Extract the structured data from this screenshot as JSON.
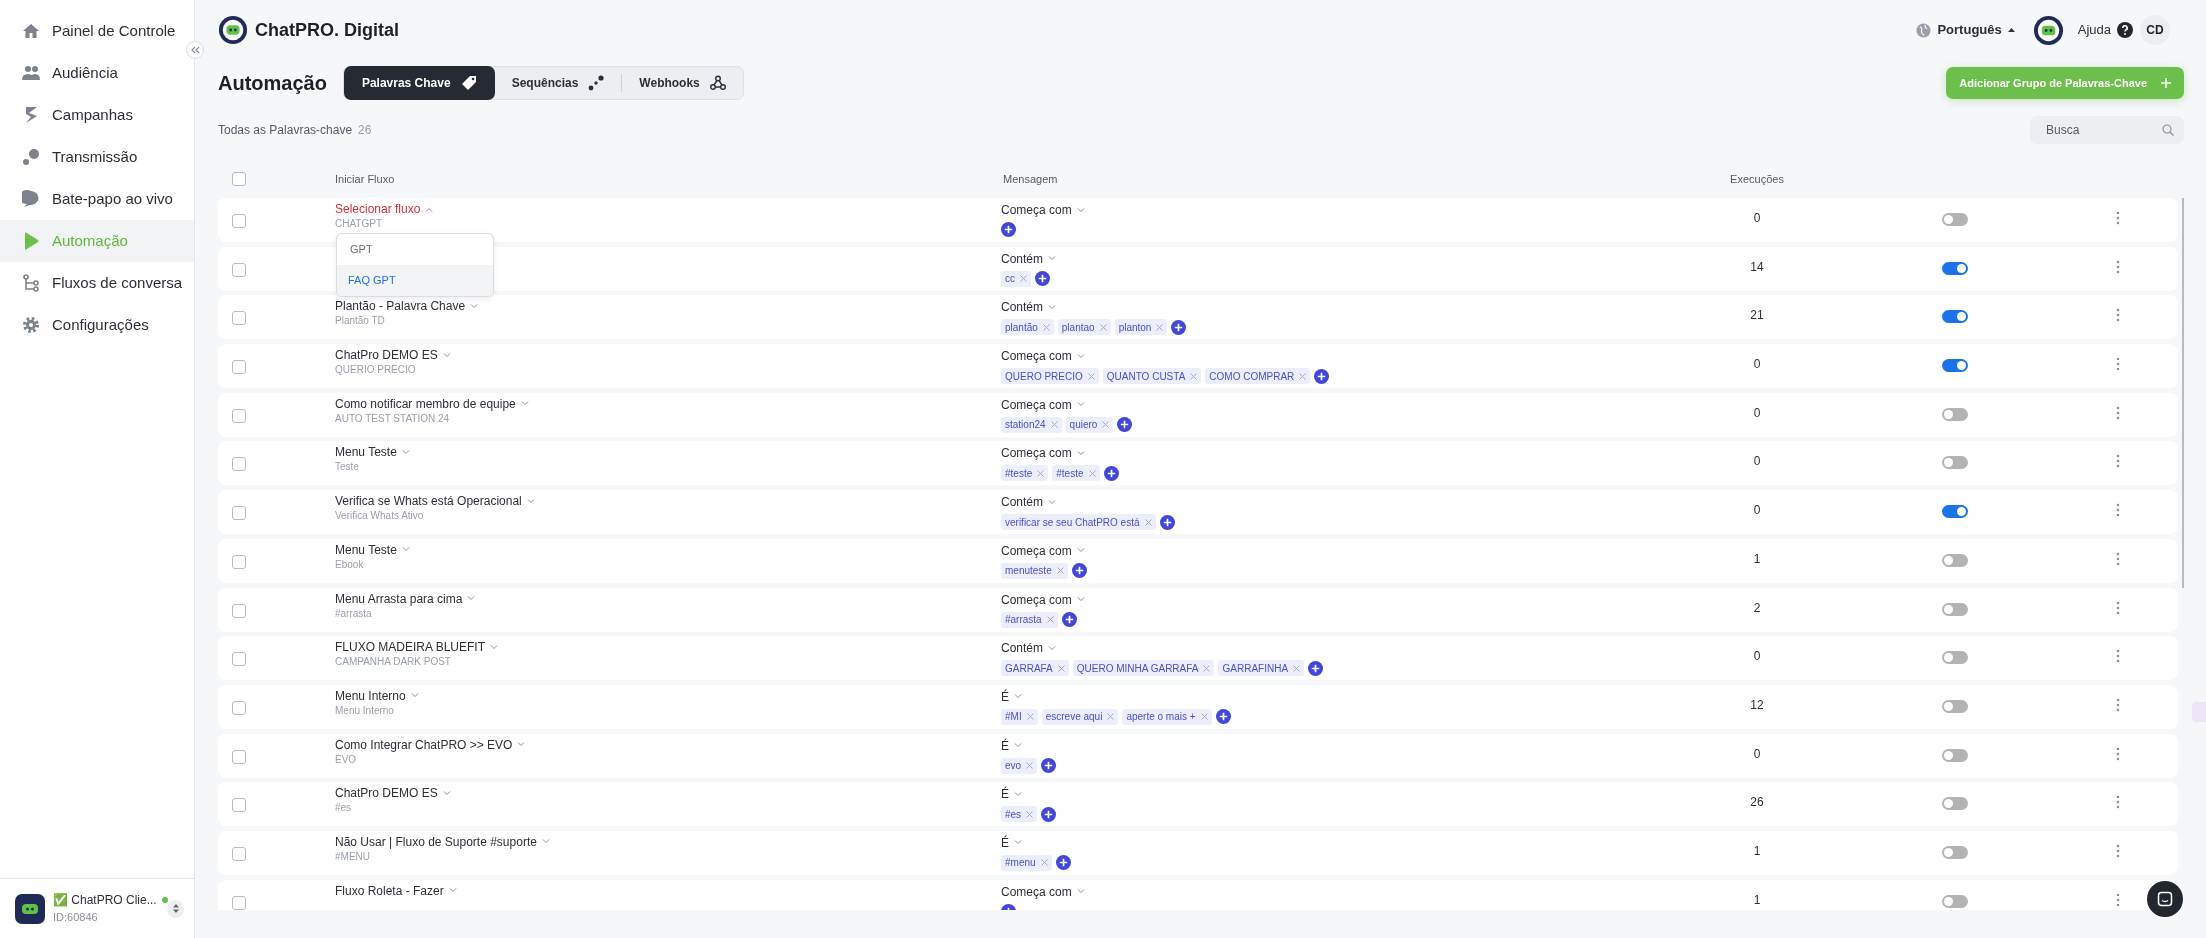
{
  "sidebar": {
    "items": [
      {
        "label": "Painel de Controle",
        "selected": false
      },
      {
        "label": "Audiência",
        "selected": false
      },
      {
        "label": "Campanhas",
        "selected": false
      },
      {
        "label": "Transmissão",
        "selected": false
      },
      {
        "label": "Bate-papo ao vivo",
        "selected": false
      },
      {
        "label": "Automação",
        "selected": true
      },
      {
        "label": "Fluxos de conversa",
        "selected": false
      },
      {
        "label": "Configurações",
        "selected": false
      }
    ],
    "account": {
      "name": "✅ ChatPRO Clie...",
      "id": "ID:60846",
      "online": true
    }
  },
  "header": {
    "brand": "ChatPRO. Digital",
    "language": "Português",
    "help": "Ajuda",
    "user_initials": "CD"
  },
  "page": {
    "title": "Automação",
    "tabs": [
      {
        "label": "Palavras Chave",
        "selected": true
      },
      {
        "label": "Sequências",
        "selected": false
      },
      {
        "label": "Webhooks",
        "selected": false
      }
    ],
    "add_button": "Adicionar Grupo de Palavras-Chave",
    "count_label": "Todas as Palavras-chave",
    "count": "26",
    "search": {
      "placeholder": "Busca"
    }
  },
  "table": {
    "columns": [
      "Iniciar Fluxo",
      "Mensagem",
      "Execuções"
    ],
    "select_all_checked": false,
    "rows": [
      {
        "checked": false,
        "kind": "placeholder",
        "flow": "Selecionar fluxo",
        "expanded": true,
        "subtitle": "CHATGPT",
        "match": "Começa com",
        "tags": [],
        "executions": "0",
        "on": false
      },
      {
        "checked": false,
        "match": "Contém",
        "tags": [
          "cc"
        ],
        "executions": "14",
        "on": true
      },
      {
        "checked": false,
        "kind": "flow",
        "flow": "Plantão - Palavra Chave",
        "expanded": false,
        "subtitle": "Plantão TD",
        "match": "Contém",
        "tags": [
          "plantão",
          "plantao",
          "planton"
        ],
        "executions": "21",
        "on": true
      },
      {
        "checked": false,
        "kind": "flow",
        "flow": "ChatPro DEMO ES",
        "expanded": false,
        "subtitle": "QUERIO PRECIO",
        "match": "Começa com",
        "tags": [
          "QUERO PRECIO",
          "QUANTO CUSTA",
          "COMO COMPRAR"
        ],
        "executions": "0",
        "on": true
      },
      {
        "checked": false,
        "kind": "flow",
        "flow": "Como notificar membro de equipe",
        "expanded": false,
        "subtitle": "AUTO TEST STATION 24",
        "match": "Começa com",
        "tags": [
          "station24",
          "quiero"
        ],
        "executions": "0",
        "on": false
      },
      {
        "checked": false,
        "kind": "flow",
        "flow": "Menu Teste",
        "expanded": false,
        "subtitle": "Teste",
        "match": "Começa com",
        "tags": [
          "#teste",
          "#teste"
        ],
        "executions": "0",
        "on": false
      },
      {
        "checked": false,
        "kind": "flow",
        "flow": "Verifica se Whats está Operacional",
        "expanded": false,
        "subtitle": "Verifica Whats Ativo",
        "match": "Contém",
        "tags": [
          "verificar se seu ChatPRO está"
        ],
        "executions": "0",
        "on": true
      },
      {
        "checked": false,
        "kind": "flow",
        "flow": "Menu Teste",
        "expanded": false,
        "subtitle": "Ebook",
        "match": "Começa com",
        "tags": [
          "menuteste"
        ],
        "executions": "1",
        "on": false
      },
      {
        "checked": false,
        "kind": "flow",
        "flow": "Menu Arrasta para cima",
        "expanded": false,
        "subtitle": "#arrasta",
        "match": "Começa com",
        "tags": [
          "#arrasta"
        ],
        "executions": "2",
        "on": false
      },
      {
        "checked": false,
        "kind": "flow",
        "flow": "FLUXO MADEIRA BLUEFIT",
        "expanded": false,
        "subtitle": "CAMPANHA DARK POST",
        "match": "Contém",
        "tags": [
          "GARRAFA",
          "QUERO MINHA GARRAFA",
          "GARRAFINHA"
        ],
        "executions": "0",
        "on": false
      },
      {
        "checked": false,
        "kind": "flow",
        "flow": "Menu Interno",
        "expanded": false,
        "subtitle": "Menu Interno",
        "match": "É",
        "tags": [
          "#MI",
          "escreve aqui",
          "aperte o mais +"
        ],
        "executions": "12",
        "on": false
      },
      {
        "checked": false,
        "kind": "flow",
        "flow": "Como Integrar ChatPRO >> EVO",
        "expanded": false,
        "subtitle": "EVO",
        "match": "É",
        "tags": [
          "evo"
        ],
        "executions": "0",
        "on": false
      },
      {
        "checked": false,
        "kind": "flow",
        "flow": "ChatPro DEMO ES",
        "expanded": false,
        "subtitle": "#es",
        "match": "É",
        "tags": [
          "#es"
        ],
        "executions": "26",
        "on": false
      },
      {
        "checked": false,
        "kind": "flow",
        "flow": "Não Usar | Fluxo de Suporte #suporte",
        "expanded": false,
        "subtitle": "#MENU",
        "match": "É",
        "tags": [
          "#menu"
        ],
        "executions": "1",
        "on": false
      },
      {
        "checked": false,
        "kind": "flow",
        "flow": "Fluxo Roleta - Fazer",
        "expanded": false,
        "match": "Começa com",
        "tags": [],
        "executions": "1",
        "on": false
      }
    ],
    "dropdown": {
      "options": [
        {
          "label": "GPT",
          "selected": false
        },
        {
          "label": "FAQ GPT",
          "selected": true
        }
      ]
    }
  }
}
